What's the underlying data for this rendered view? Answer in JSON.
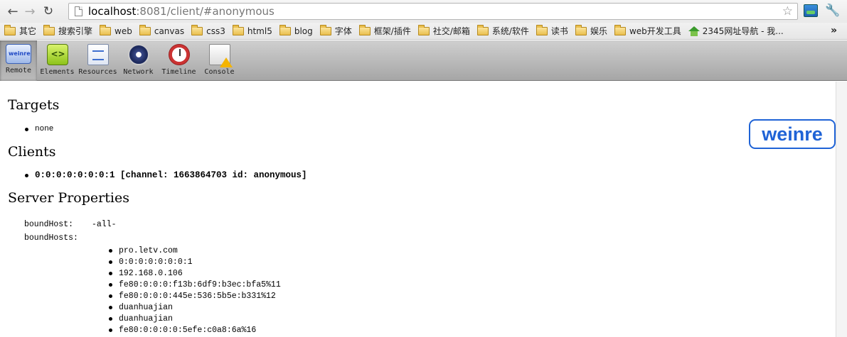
{
  "browser": {
    "url_host": "localhost",
    "url_rest": ":8081/client/#anonymous",
    "back_icon": "back-arrow-icon",
    "forward_icon": "forward-arrow-icon",
    "reload_icon": "reload-icon",
    "star_icon": "star-icon",
    "wrench_icon": "wrench-icon"
  },
  "bookmarks": [
    {
      "label": "其它"
    },
    {
      "label": "搜索引擎"
    },
    {
      "label": "web"
    },
    {
      "label": "canvas"
    },
    {
      "label": "css3"
    },
    {
      "label": "html5"
    },
    {
      "label": "blog"
    },
    {
      "label": "字体"
    },
    {
      "label": "框架/插件"
    },
    {
      "label": "社交/邮箱"
    },
    {
      "label": "系统/软件"
    },
    {
      "label": "读书"
    },
    {
      "label": "娱乐"
    },
    {
      "label": "web开发工具"
    },
    {
      "label": "2345网址导航 - 我..."
    }
  ],
  "bookmarks_overflow": "»",
  "tools": [
    {
      "label": "Remote",
      "active": true
    },
    {
      "label": "Elements"
    },
    {
      "label": "Resources"
    },
    {
      "label": "Network"
    },
    {
      "label": "Timeline"
    },
    {
      "label": "Console"
    }
  ],
  "page": {
    "targets_heading": "Targets",
    "targets": [
      "none"
    ],
    "clients_heading": "Clients",
    "clients": [
      "0:0:0:0:0:0:0:1 [channel: 1663864703 id: anonymous]"
    ],
    "server_heading": "Server Properties",
    "logo_text": "weinre",
    "bound_host_key": "boundHost:",
    "bound_host_value": "-all-",
    "bound_hosts_key": "boundHosts:",
    "bound_hosts": [
      "pro.letv.com",
      "0:0:0:0:0:0:0:1",
      "192.168.0.106",
      "fe80:0:0:0:f13b:6df9:b3ec:bfa5%11",
      "fe80:0:0:0:445e:536:5b5e:b331%12",
      "duanhuajian",
      "duanhuajian",
      "fe80:0:0:0:0:5efe:c0a8:6a%16"
    ]
  }
}
